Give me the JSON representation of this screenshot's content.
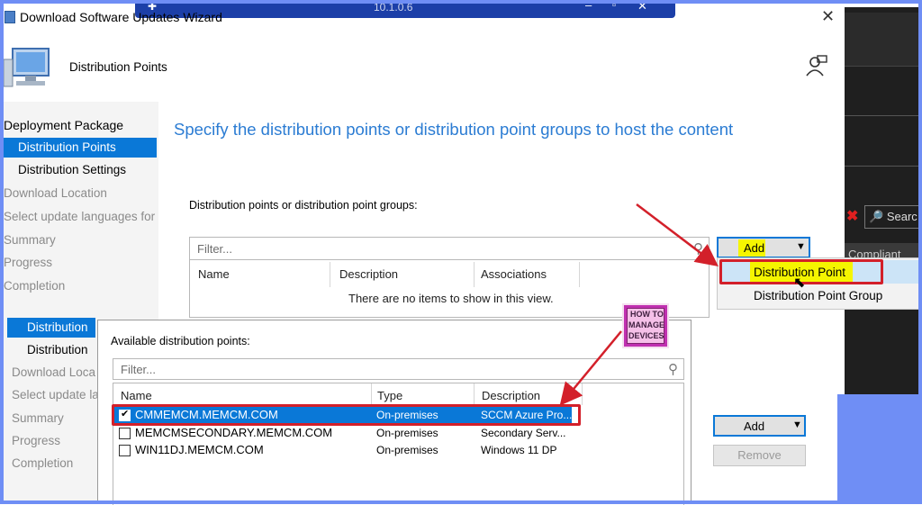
{
  "window": {
    "title": "Download Software Updates Wizard",
    "remote_title": "10.1.0.6"
  },
  "header": {
    "page_title": "Distribution Points"
  },
  "nav": {
    "items": [
      {
        "label": "Deployment Package"
      },
      {
        "label": "Distribution Points"
      },
      {
        "label": "Distribution Settings"
      },
      {
        "label": "Download Location"
      },
      {
        "label": "Select update languages for"
      },
      {
        "label": "Summary"
      },
      {
        "label": "Progress"
      },
      {
        "label": "Completion"
      }
    ]
  },
  "main": {
    "heading": "Specify the distribution points or distribution point groups to host the content",
    "list_label": "Distribution points or distribution point groups:",
    "filter_placeholder": "Filter...",
    "columns": [
      "Name",
      "Description",
      "Associations"
    ],
    "empty_text": "There are no items to show in this view.",
    "add_label": "Add"
  },
  "add_menu": {
    "items": [
      "Distribution Point",
      "Distribution Point Group"
    ]
  },
  "bg_window": {
    "search_label": "Searc",
    "column": "Compliant"
  },
  "nav2": {
    "items": [
      {
        "label": "Distribution"
      },
      {
        "label": "Distribution"
      },
      {
        "label": "Download Loca"
      },
      {
        "label": "Select update la"
      },
      {
        "label": "Summary"
      },
      {
        "label": "Progress"
      },
      {
        "label": "Completion"
      }
    ]
  },
  "dialog": {
    "label": "Available distribution points:",
    "filter_placeholder": "Filter...",
    "columns": [
      "Name",
      "Type",
      "Description"
    ],
    "rows": [
      {
        "name": "CMMEMCM.MEMCM.COM",
        "type": "On-premises",
        "description": "SCCM Azure Pro...",
        "checked": true
      },
      {
        "name": "MEMCMSECONDARY.MEMCM.COM",
        "type": "On-premises",
        "description": "Secondary Serv...",
        "checked": false
      },
      {
        "name": "WIN11DJ.MEMCM.COM",
        "type": "On-premises",
        "description": "Windows 11 DP",
        "checked": false
      }
    ]
  },
  "buttons2": {
    "add_label": "Add",
    "remove_label": "Remove"
  },
  "logo": {
    "lines": [
      "HOW TO",
      "MANAGE",
      "DEVICES"
    ]
  },
  "colors": {
    "accent": "#0a78d7",
    "highlight": "#f5f500",
    "annotation": "#d3202a",
    "heading": "#2b7cd3",
    "frame": "#6f8ef5"
  }
}
